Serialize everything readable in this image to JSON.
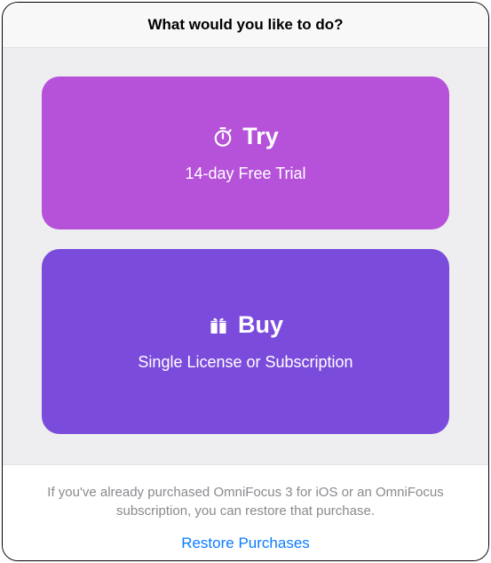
{
  "header": {
    "title": "What would you like to do?"
  },
  "cards": {
    "try": {
      "title": "Try",
      "subtitle": "14-day Free Trial"
    },
    "buy": {
      "title": "Buy",
      "subtitle": "Single License or Subscription"
    }
  },
  "footer": {
    "text": "If you've already purchased OmniFocus 3 for iOS or an OmniFocus subscription, you can restore that purchase.",
    "restore_label": "Restore Purchases"
  }
}
